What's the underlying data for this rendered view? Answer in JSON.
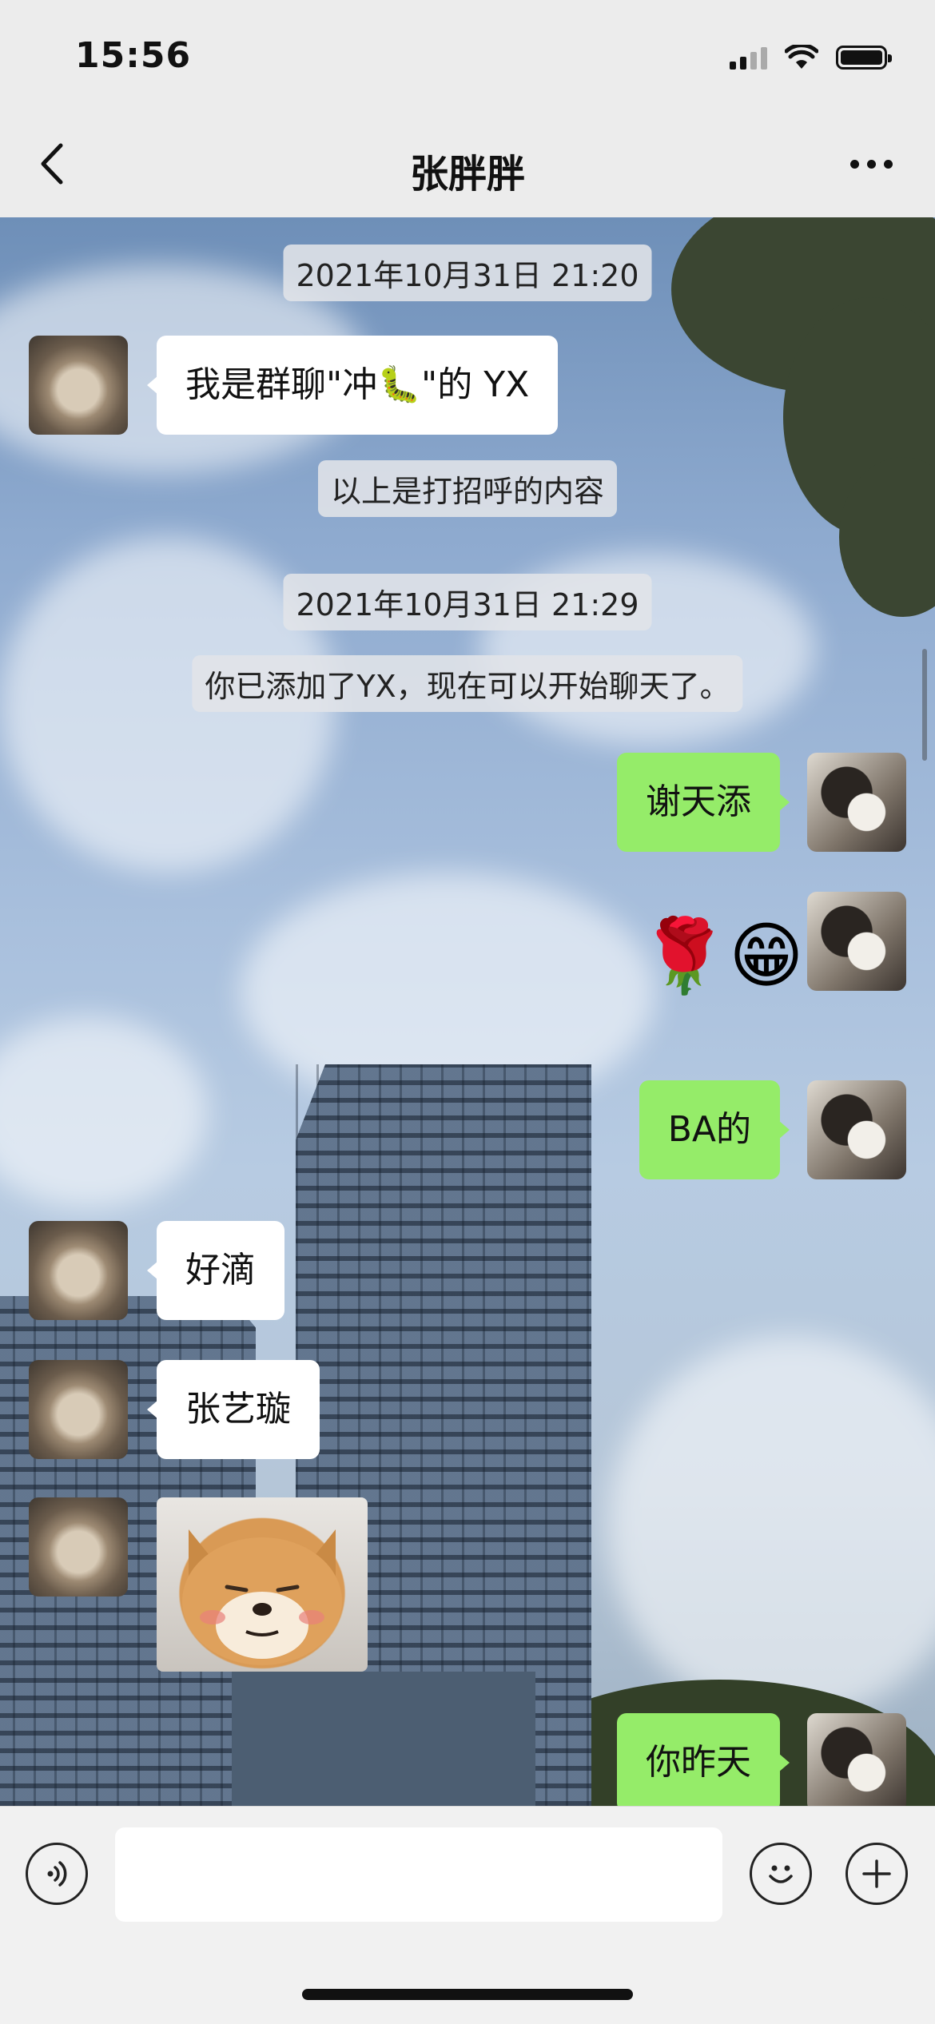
{
  "status_bar": {
    "time": "15:56"
  },
  "nav": {
    "title": "张胖胖"
  },
  "messages": {
    "ts1": "2021年10月31日 21:20",
    "m1": "我是群聊\"冲🐛\"的 YX",
    "sys1": "以上是打招呼的内容",
    "ts2": "2021年10月31日 21:29",
    "sys2": "你已添加了YX，现在可以开始聊天了。",
    "m2": "谢天添",
    "m3_sticker": "🌹😁",
    "m4": "BA的",
    "m5": "好滴",
    "m6": "张艺璇",
    "m8": "你昨天"
  },
  "input": {
    "placeholder": ""
  },
  "icons": [
    "back-icon",
    "more-icon",
    "voice-icon",
    "emoji-icon",
    "add-icon",
    "signal-icon",
    "wifi-icon",
    "battery-icon"
  ],
  "colors": {
    "outgoing_bubble": "#95ec69",
    "incoming_bubble": "#ffffff"
  }
}
